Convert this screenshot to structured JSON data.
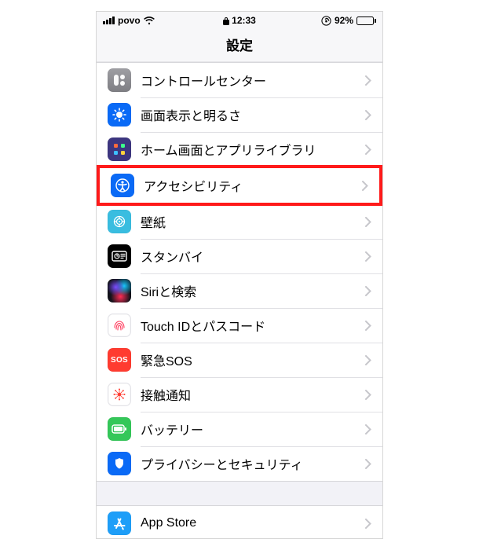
{
  "status": {
    "carrier": "povo",
    "time": "12:33",
    "battery_pct": "92%"
  },
  "nav": {
    "title": "設定"
  },
  "groups": [
    {
      "rows": [
        {
          "label": "コントロールセンター"
        },
        {
          "label": "画面表示と明るさ"
        },
        {
          "label": "ホーム画面とアプリライブラリ"
        },
        {
          "label": "アクセシビリティ",
          "highlighted": true
        },
        {
          "label": "壁紙"
        },
        {
          "label": "スタンバイ"
        },
        {
          "label": "Siriと検索"
        },
        {
          "label": "Touch IDとパスコード"
        },
        {
          "label": "緊急SOS",
          "badge_text": "SOS"
        },
        {
          "label": "接触通知"
        },
        {
          "label": "バッテリー"
        },
        {
          "label": "プライバシーとセキュリティ"
        }
      ]
    },
    {
      "rows": [
        {
          "label": "App Store"
        }
      ]
    }
  ]
}
